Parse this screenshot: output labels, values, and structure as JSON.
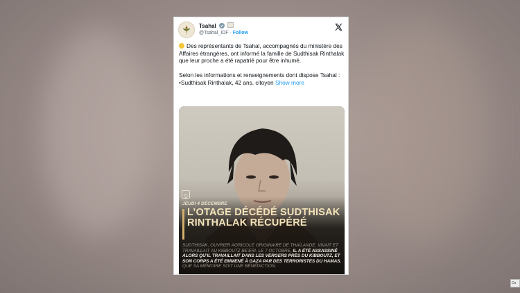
{
  "tweet": {
    "author_name": "Tsahal",
    "handle": "@Tsahal_IDF",
    "separator": " · ",
    "follow_label": "Follow",
    "body_paragraph_1": "Des représentants de Tsahal, accompagnés du ministère des Affaires étrangères, ont informé la famille de Sudthisak Rinthalak que leur proche a été rapatrié pour être inhumé.",
    "body_paragraph_2": "Selon les informations et renseignements dont dispose Tsahal :",
    "body_paragraph_3": "•Sudthisak Rinthalak, 42 ans, citoyen",
    "show_more_label": "Show more"
  },
  "media": {
    "date_label": "JEUDI 4 DÉCEMBRE",
    "title": "L’OTAGE DÉCÉDÉ SUDTHISAK RINTHALAK RÉCUPÉRÉ",
    "description_part1": "SUDTHISAK, OUVRIER AGRICOLE ORIGINAIRE DE THAÏLANDE, VIVAIT ET TRAVAILLAIT AU KIBBOUTZ BE’ERI. LE 7 OCTOBRE, ",
    "description_bold": "IL A ÉTÉ ASSASSINÉ ALORS QU’IL TRAVAILLAIT DANS LES VERGERS PRÈS DU KIBBOUTZ, ET SON CORPS A ÉTÉ EMMENÉ À GAZA PAR DES TERRORISTES DU HAMAS.",
    "description_part2": " QUE SA MÉMOIRE SOIT UNE BÉNÉDICTION."
  },
  "corner_label": "Co",
  "colors": {
    "link": "#1d9bf0",
    "title_gold": "#f3e3b9",
    "accent_bar": "#d4af6a",
    "emoji_dot": "#f5c63a"
  },
  "icons": {
    "avatar": "idf-emblem-icon",
    "verified": "verified-badge-icon",
    "x_logo": "x-logo-icon",
    "emoji": "yellow-circle-icon"
  }
}
